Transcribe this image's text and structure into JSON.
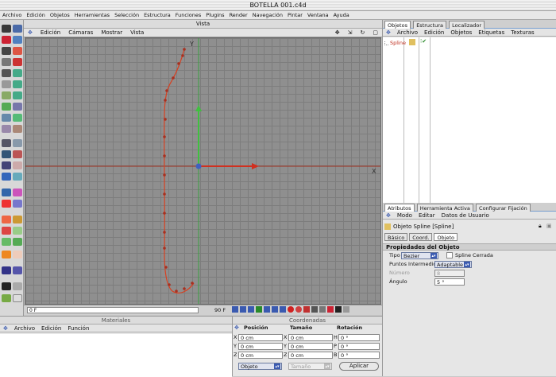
{
  "window": {
    "title": "BOTELLA 001.c4d"
  },
  "menubar": [
    "Archivo",
    "Edición",
    "Objetos",
    "Herramientas",
    "Selección",
    "Estructura",
    "Funciones",
    "Plugins",
    "Render",
    "Navegación",
    "Pintar",
    "Ventana",
    "Ayuda"
  ],
  "viewport": {
    "title": "Vista",
    "menu": [
      "Edición",
      "Cámaras",
      "Mostrar",
      "Vista"
    ],
    "axis_y": "Y",
    "axis_x": "X"
  },
  "timeline": {
    "start": "0 F",
    "end": "90 F"
  },
  "objects_panel": {
    "tabs": [
      "Objetos",
      "Estructura",
      "Localizador"
    ],
    "menu": [
      "Archivo",
      "Edición",
      "Objetos",
      "Etiquetas",
      "Texturas"
    ],
    "items": [
      {
        "name": "Spline"
      }
    ]
  },
  "attributes_panel": {
    "tabs": [
      "Atributos",
      "Herramienta Activa",
      "Configurar Fijación"
    ],
    "menu": [
      "Modo",
      "Editar",
      "Datos de Usuario"
    ],
    "object_label": "Objeto Spline [Spline]",
    "subtabs": [
      "Básico",
      "Coord.",
      "Objeto"
    ],
    "section_title": "Propiedades del Objeto",
    "tipo_label": "Tipo",
    "tipo_value": "Bezier",
    "closed_label": "Spline Cerrada",
    "inter_label": "Puntos Intermedios",
    "inter_value": "Adaptable",
    "numero_label": "Número",
    "numero_value": "8",
    "angulo_label": "Ángulo",
    "angulo_value": "5 °"
  },
  "materials_panel": {
    "title": "Materiales",
    "menu": [
      "Archivo",
      "Edición",
      "Función"
    ]
  },
  "coords_panel": {
    "title": "Coordenadas",
    "headers": [
      "Posición",
      "Tamaño",
      "Rotación"
    ],
    "rows": [
      {
        "a": "X",
        "pos": "0 cm",
        "b": "X",
        "size": "0 cm",
        "c": "H",
        "rot": "0 °"
      },
      {
        "a": "Y",
        "pos": "0 cm",
        "b": "Y",
        "size": "0 cm",
        "c": "P",
        "rot": "0 °"
      },
      {
        "a": "Z",
        "pos": "0 cm",
        "b": "Z",
        "size": "0 cm",
        "c": "B",
        "rot": "0 °"
      }
    ],
    "mode_value": "Objeto",
    "size_mode_value": "Tamaño",
    "apply_label": "Aplicar"
  }
}
